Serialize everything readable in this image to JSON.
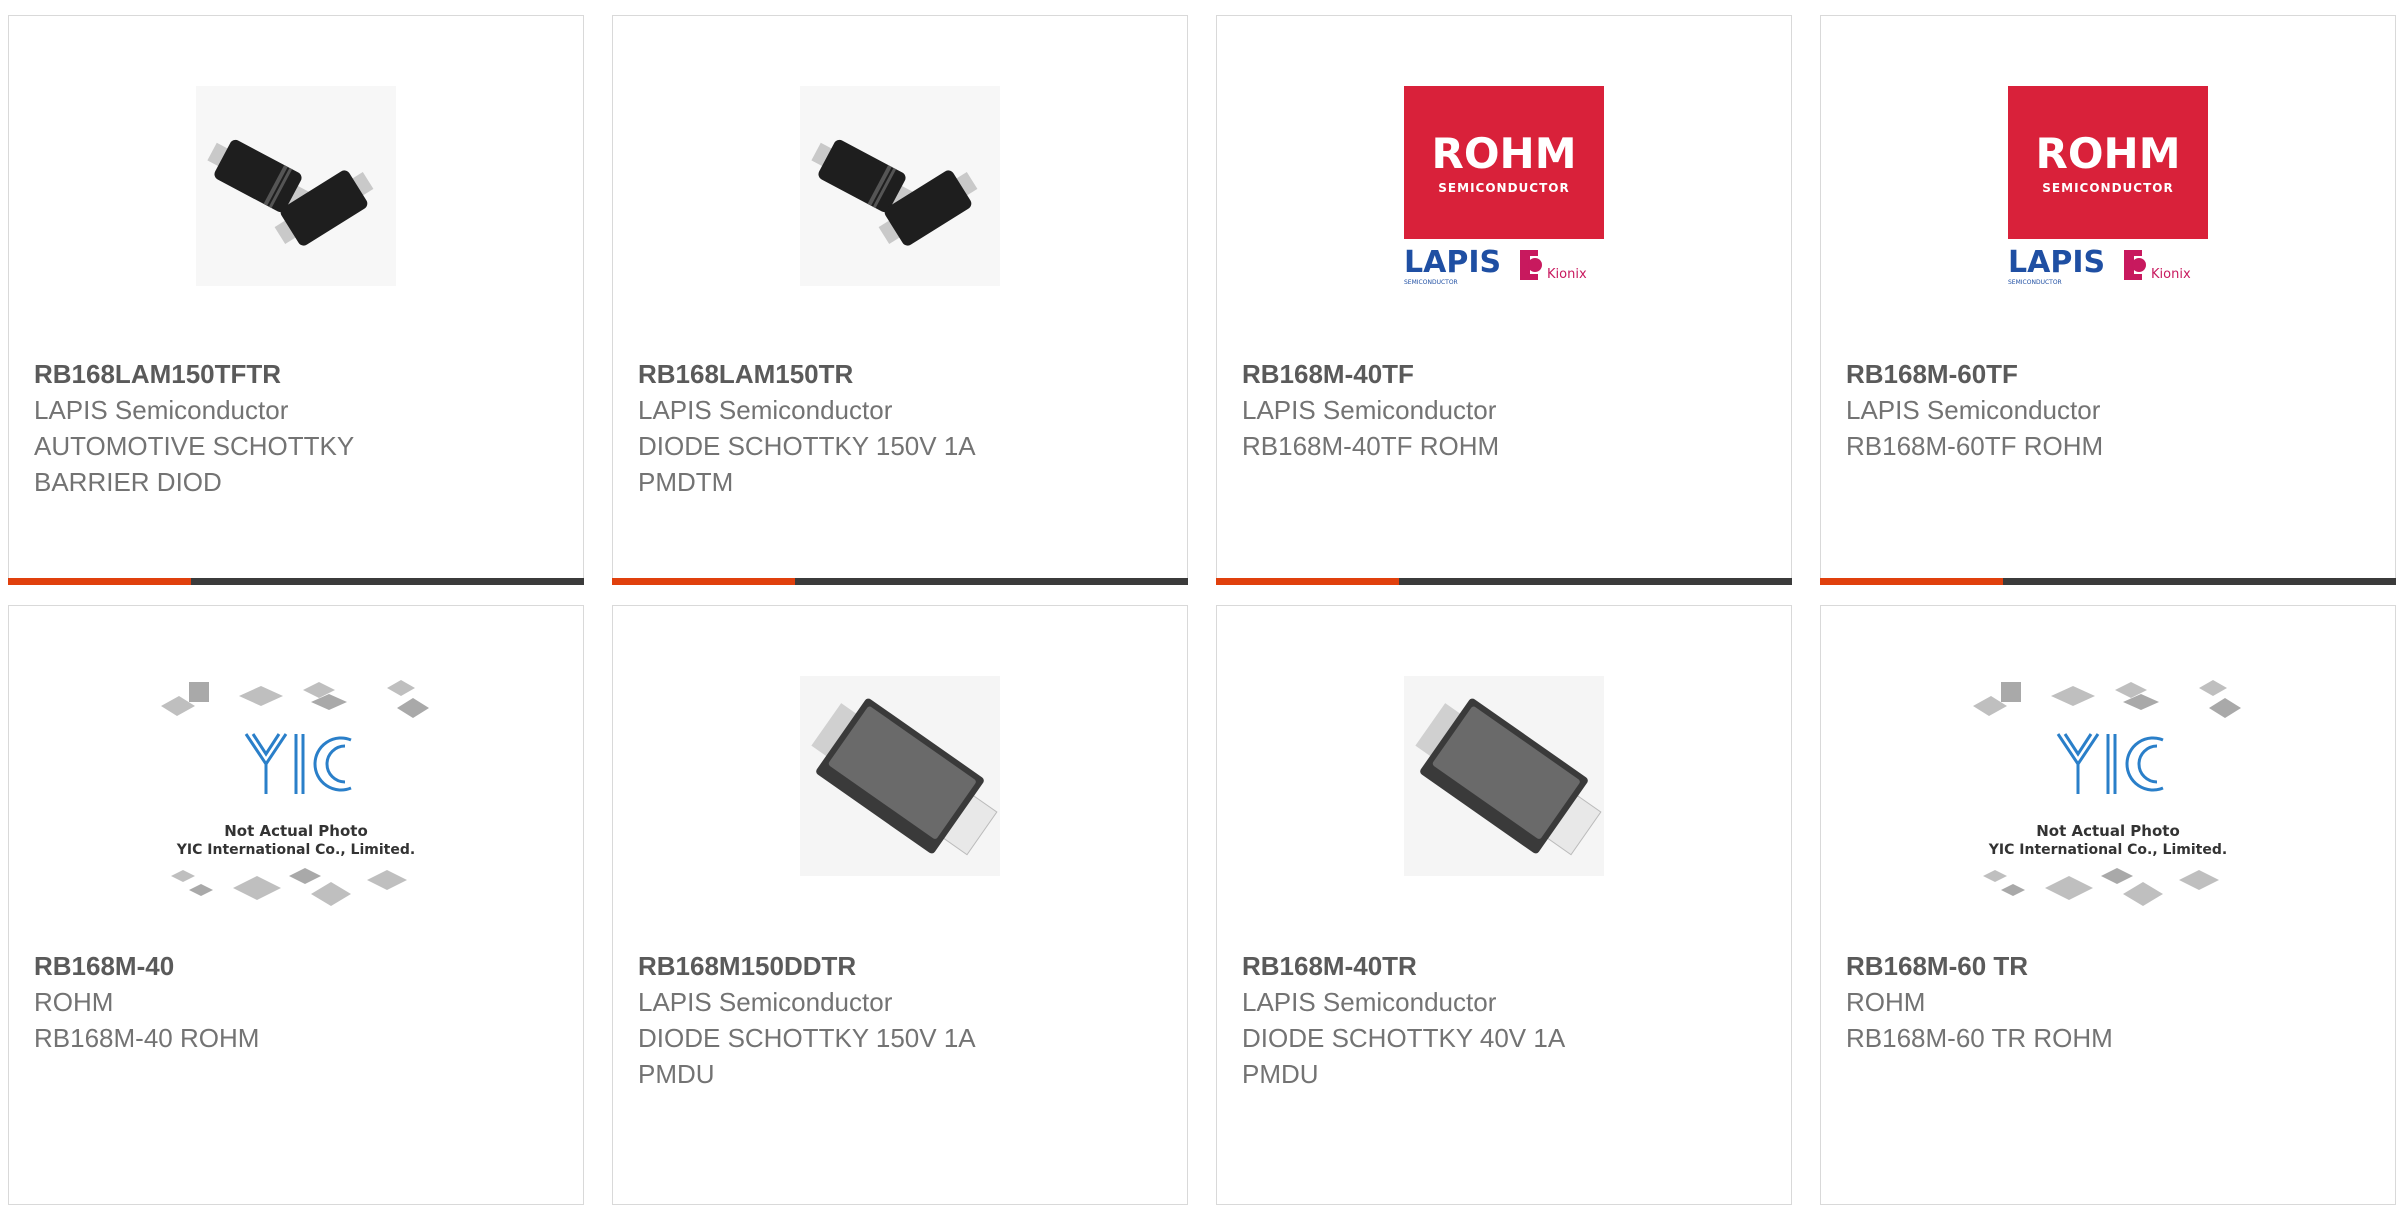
{
  "colors": {
    "accent": "#e0400d",
    "bar_dark": "#3b3b3b",
    "part_number": "#5a5a5a",
    "text": "#737373",
    "rohm_red": "#d9213a",
    "lapis_blue": "#1f4fa3",
    "yic_blue": "#2a7fc9"
  },
  "products": [
    {
      "part_number": "RB168LAM150TFTR",
      "manufacturer": "LAPIS Semiconductor",
      "description_1": "AUTOMOTIVE SCHOTTKY",
      "description_2": "BARRIER DIOD",
      "image": "sod-package-pair-icon"
    },
    {
      "part_number": "RB168LAM150TR",
      "manufacturer": "LAPIS Semiconductor",
      "description_1": "DIODE SCHOTTKY 150V 1A",
      "description_2": "PMDTM",
      "image": "sod-package-pair-icon"
    },
    {
      "part_number": "RB168M-40TF",
      "manufacturer": "LAPIS Semiconductor",
      "description_1": "RB168M-40TF ROHM",
      "description_2": "",
      "image": "rohm-logo",
      "logo": {
        "brand": "ROHM",
        "sub": "SEMICONDUCTOR",
        "brand2": "LAPIS",
        "brand2_sub": "SEMICONDUCTOR",
        "brand3": "Kionix"
      }
    },
    {
      "part_number": "RB168M-60TF",
      "manufacturer": "LAPIS Semiconductor",
      "description_1": "RB168M-60TF ROHM",
      "description_2": "",
      "image": "rohm-logo",
      "logo": {
        "brand": "ROHM",
        "sub": "SEMICONDUCTOR",
        "brand2": "LAPIS",
        "brand2_sub": "SEMICONDUCTOR",
        "brand3": "Kionix"
      }
    },
    {
      "part_number": "RB168M-40",
      "manufacturer": "ROHM",
      "description_1": "RB168M-40 ROHM",
      "description_2": "",
      "image": "yic-placeholder",
      "placeholder": {
        "line1": "Not Actual Photo",
        "line2": "YIC International Co., Limited."
      }
    },
    {
      "part_number": "RB168M150DDTR",
      "manufacturer": "LAPIS Semiconductor",
      "description_1": "DIODE SCHOTTKY 150V 1A",
      "description_2": "PMDU",
      "image": "pmdu-package-icon"
    },
    {
      "part_number": "RB168M-40TR",
      "manufacturer": "LAPIS Semiconductor",
      "description_1": "DIODE SCHOTTKY 40V 1A",
      "description_2": "PMDU",
      "image": "pmdu-package-icon"
    },
    {
      "part_number": "RB168M-60 TR",
      "manufacturer": "ROHM",
      "description_1": "RB168M-60 TR ROHM",
      "description_2": "",
      "image": "yic-placeholder",
      "placeholder": {
        "line1": "Not Actual Photo",
        "line2": "YIC International Co., Limited."
      }
    }
  ]
}
